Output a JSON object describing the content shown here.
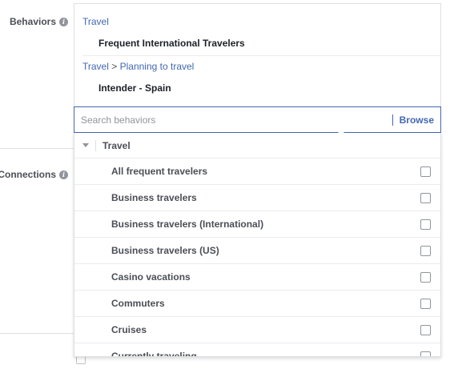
{
  "labels": {
    "behaviors": "Behaviors",
    "connections": "Connections"
  },
  "selected": [
    {
      "path": [
        "Travel"
      ],
      "item": "Frequent International Travelers"
    },
    {
      "path": [
        "Travel",
        "Planning to travel"
      ],
      "path_separator": ">",
      "item": "Intender - Spain"
    }
  ],
  "search": {
    "placeholder": "Search behaviors",
    "value": "",
    "browse_label": "Browse"
  },
  "dropdown": {
    "category": "Travel",
    "items": [
      {
        "label": "All frequent travelers",
        "checked": false
      },
      {
        "label": "Business travelers",
        "checked": false
      },
      {
        "label": "Business travelers (International)",
        "checked": false
      },
      {
        "label": "Business travelers (US)",
        "checked": false
      },
      {
        "label": "Casino vacations",
        "checked": false
      },
      {
        "label": "Commuters",
        "checked": false
      },
      {
        "label": "Cruises",
        "checked": false
      },
      {
        "label": "Currently traveling",
        "checked": false
      }
    ]
  },
  "colors": {
    "link": "#4267b2",
    "text": "#1d2129",
    "muted": "#90949c",
    "border": "#dddfe2"
  }
}
